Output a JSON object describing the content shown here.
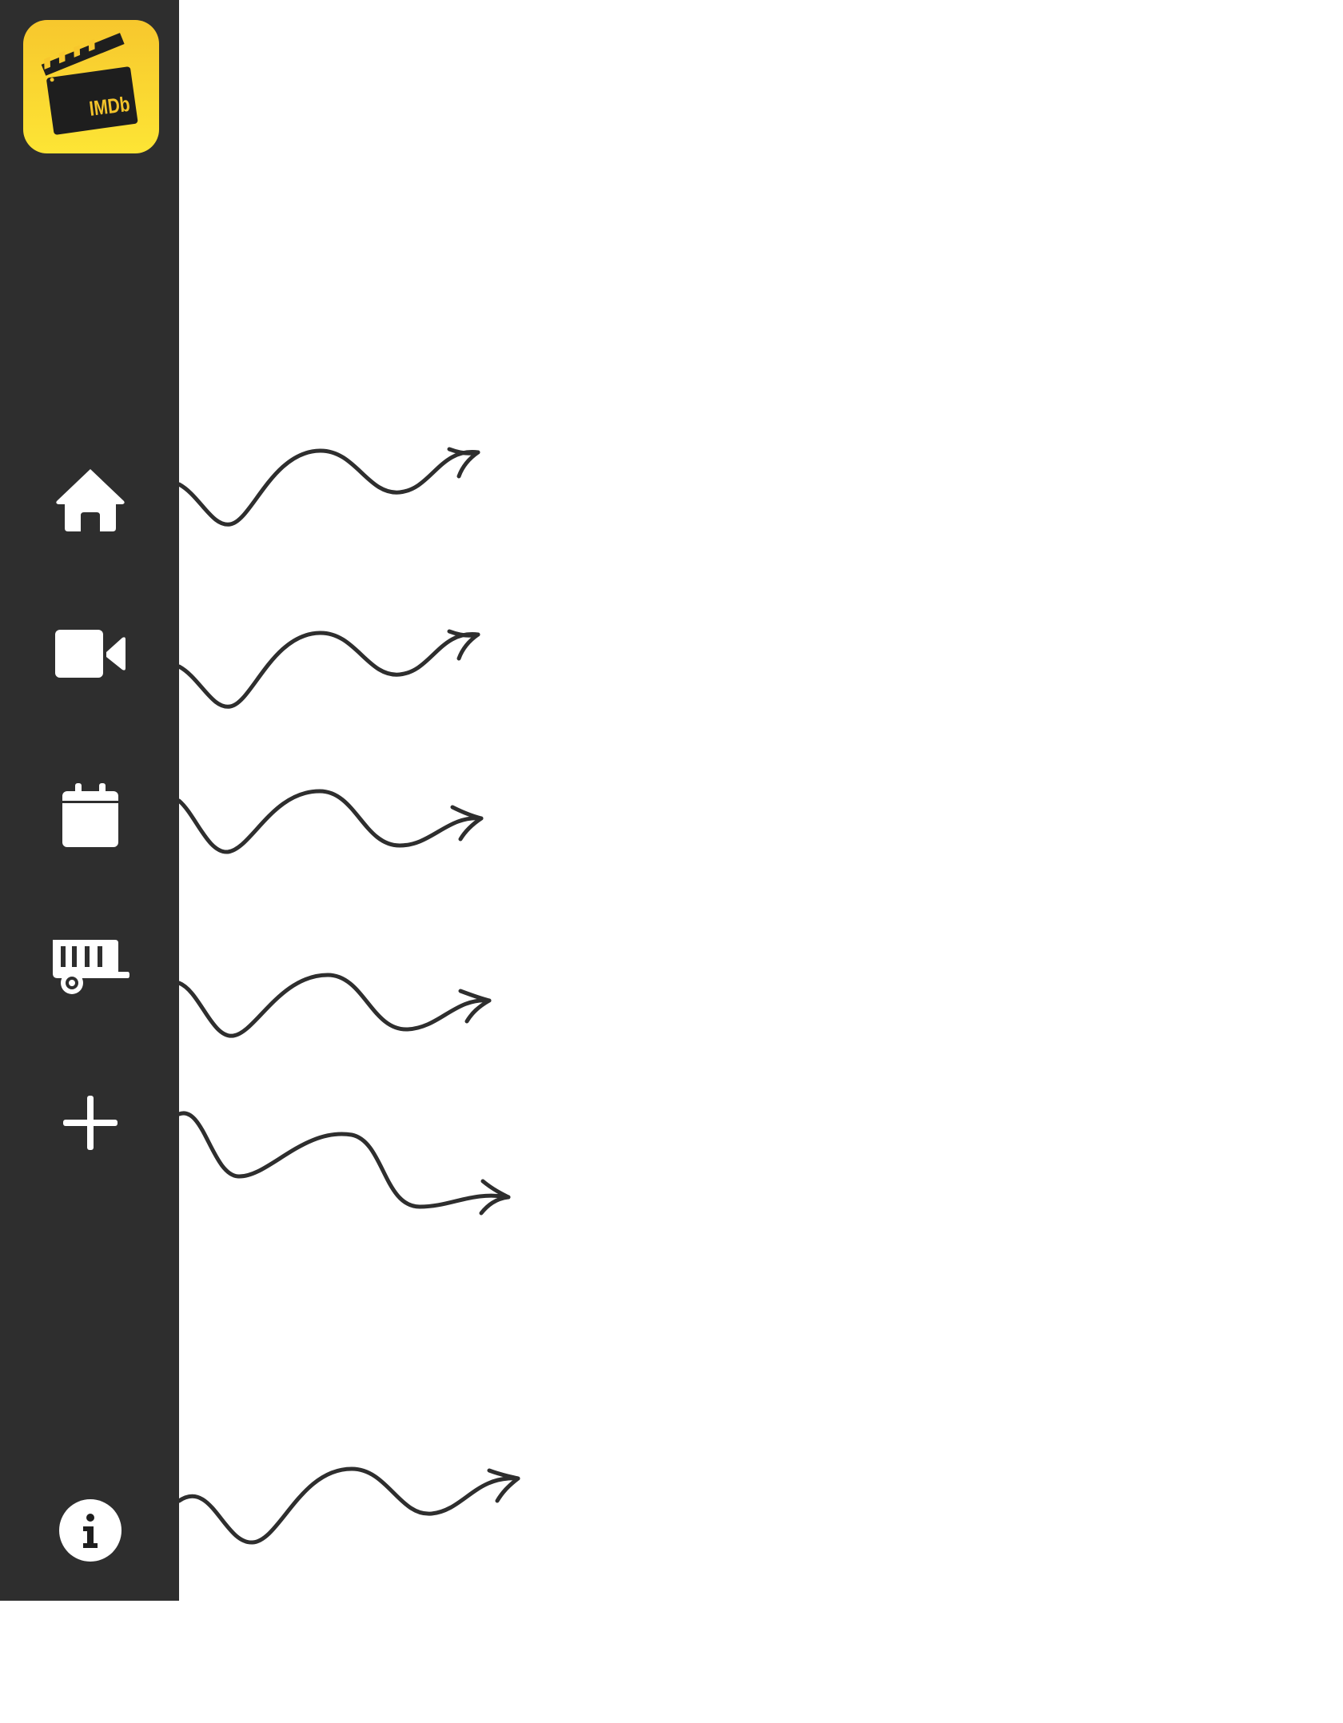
{
  "app": {
    "logo_text": "IMDb",
    "colors": {
      "sidebar_bg": "#2e2e2e",
      "logo_gradient_top": "#f7c72d",
      "logo_gradient_bottom": "#fde535",
      "icon": "#ffffff",
      "arrow": "#2e2e2e"
    }
  },
  "sidebar": {
    "items": [
      {
        "icon": "home-icon"
      },
      {
        "icon": "video-camera-icon"
      },
      {
        "icon": "calendar-icon"
      },
      {
        "icon": "trailer-icon"
      },
      {
        "icon": "plus-icon"
      },
      {
        "icon": "info-icon"
      }
    ]
  }
}
